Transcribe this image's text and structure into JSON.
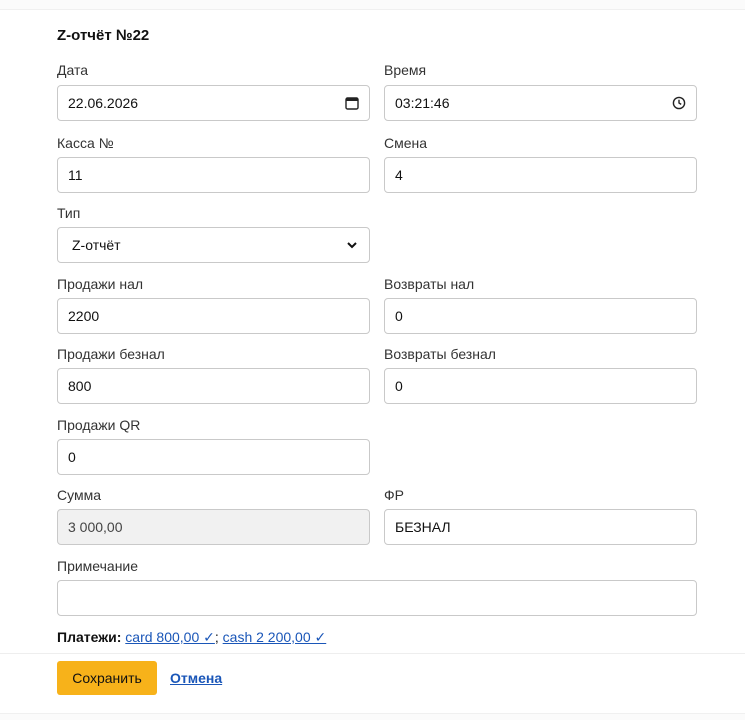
{
  "title": "Z-отчёт №22",
  "fields": {
    "date": {
      "label": "Дата",
      "value": "22.06.2026"
    },
    "time": {
      "label": "Время",
      "value": "03:21:46"
    },
    "register": {
      "label": "Касса №",
      "value": "11"
    },
    "shift": {
      "label": "Смена",
      "value": "4"
    },
    "type": {
      "label": "Тип",
      "value": "Z-отчёт"
    },
    "sales_cash": {
      "label": "Продажи нал",
      "value": "2200"
    },
    "returns_cash": {
      "label": "Возвраты нал",
      "value": "0"
    },
    "sales_card": {
      "label": "Продажи безнал",
      "value": "800"
    },
    "returns_card": {
      "label": "Возвраты безнал",
      "value": "0"
    },
    "sales_qr": {
      "label": "Продажи QR",
      "value": "0"
    },
    "total": {
      "label": "Сумма",
      "value": "3 000,00"
    },
    "fr": {
      "label": "ФР",
      "value": "БЕЗНАЛ"
    },
    "note": {
      "label": "Примечание",
      "value": ""
    }
  },
  "payments": {
    "label": "Платежи:",
    "card_link": "card 800,00 ✓",
    "separator": ";",
    "cash_link": "cash 2 200,00 ✓"
  },
  "buttons": {
    "save": "Сохранить",
    "cancel": "Отмена"
  },
  "icons": {
    "date": "calendar-icon",
    "time": "clock-icon",
    "type": "chevron-down-icon"
  },
  "colors": {
    "accent": "#f7b21a",
    "link": "#1a56b8"
  }
}
